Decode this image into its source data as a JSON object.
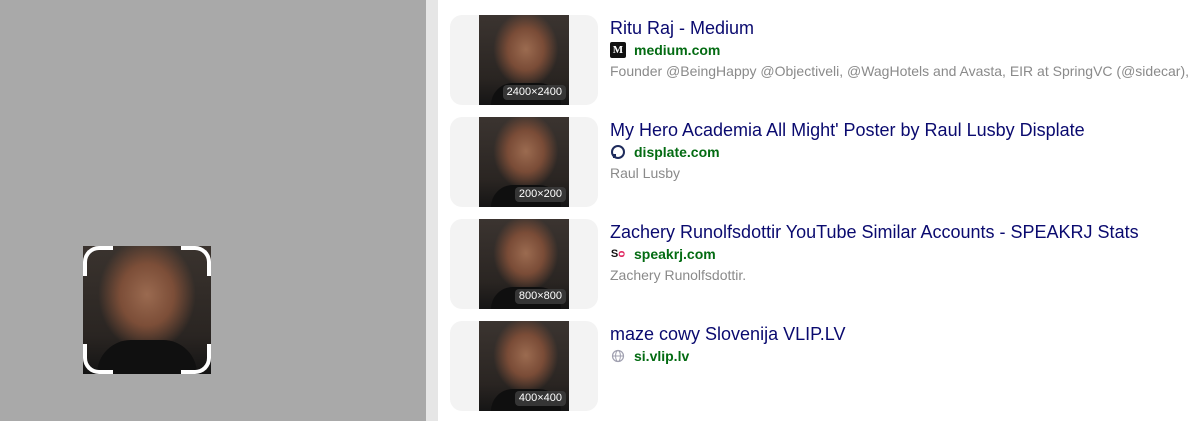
{
  "results": [
    {
      "title": "Ritu Raj - Medium",
      "favicon_icon": "medium-icon",
      "favicon_text": "M",
      "domain": "medium.com",
      "snippet": "Founder @BeingHappy @Objectiveli, @WagHotels and Avasta, EIR at SpringVC (@sidecar),",
      "size": "2400×2400"
    },
    {
      "title": "My Hero Academia All Might' Poster by Raul Lusby Displate",
      "favicon_icon": "displate-icon",
      "favicon_text": "D",
      "domain": "displate.com",
      "snippet": "Raul Lusby",
      "size": "200×200"
    },
    {
      "title": "Zachery Runolfsdottir YouTube Similar Accounts - SPEAKRJ Stats",
      "favicon_icon": "speakrj-icon",
      "favicon_text": "S",
      "domain": "speakrj.com",
      "snippet": "Zachery Runolfsdottir.",
      "size": "800×800"
    },
    {
      "title": "maze cowy Slovenija VLIP.LV",
      "favicon_icon": "globe-icon",
      "favicon_text": "",
      "domain": "si.vlip.lv",
      "snippet": "",
      "size": "400×400"
    }
  ],
  "colors": {
    "title": "#0a0a6f",
    "domain": "#036b12",
    "snippet": "#8a8a8a",
    "left_panel": "#a9a9a9"
  }
}
